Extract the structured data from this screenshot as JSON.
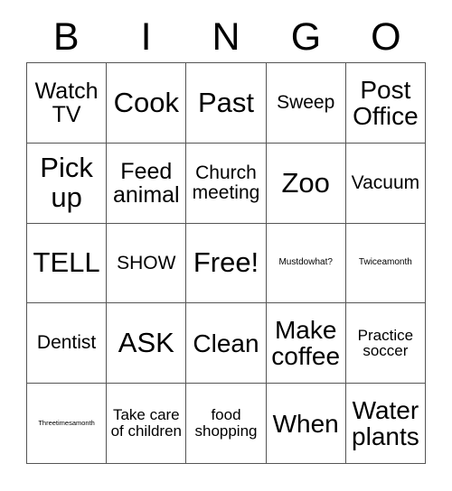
{
  "card": {
    "title": "BINGO",
    "header_letters": [
      "B",
      "I",
      "N",
      "G",
      "O"
    ],
    "colors": {
      "background": "#ffffff",
      "text": "#000000",
      "grid_line": "#555555"
    },
    "grid": {
      "columns": 5,
      "rows": 5,
      "free_space": "Free!",
      "free_space_position": {
        "row": 3,
        "column": 3
      }
    },
    "cells": [
      [
        {
          "text": "Watch TV",
          "size": "lg"
        },
        {
          "text": "Cook",
          "size": "xxl"
        },
        {
          "text": "Past",
          "size": "xxl"
        },
        {
          "text": "Sweep",
          "size": "md"
        },
        {
          "text": "Post Office",
          "size": "xl"
        }
      ],
      [
        {
          "text": "Pick up",
          "size": "xxl"
        },
        {
          "text": "Feed animal",
          "size": "lg"
        },
        {
          "text": "Church meeting",
          "size": "md"
        },
        {
          "text": "Zoo",
          "size": "xxl"
        },
        {
          "text": "Vacuum",
          "size": "md"
        }
      ],
      [
        {
          "text": "TELL",
          "size": "xxl"
        },
        {
          "text": "SHOW",
          "size": "md"
        },
        {
          "text": "Free!",
          "size": "xxl"
        },
        {
          "text": "Mustdowhat?",
          "size": "xxs"
        },
        {
          "text": "Twiceamonth",
          "size": "xxs"
        }
      ],
      [
        {
          "text": "Dentist",
          "size": "md"
        },
        {
          "text": "ASK",
          "size": "xxl"
        },
        {
          "text": "Clean",
          "size": "xl"
        },
        {
          "text": "Make coffee",
          "size": "xl"
        },
        {
          "text": "Practice soccer",
          "size": "sm"
        }
      ],
      [
        {
          "text": "Threetimesamonth",
          "size": "tiny"
        },
        {
          "text": "Take care of children",
          "size": "sm"
        },
        {
          "text": "food shopping",
          "size": "sm"
        },
        {
          "text": "When",
          "size": "xl"
        },
        {
          "text": "Water plants",
          "size": "xl"
        }
      ]
    ]
  }
}
